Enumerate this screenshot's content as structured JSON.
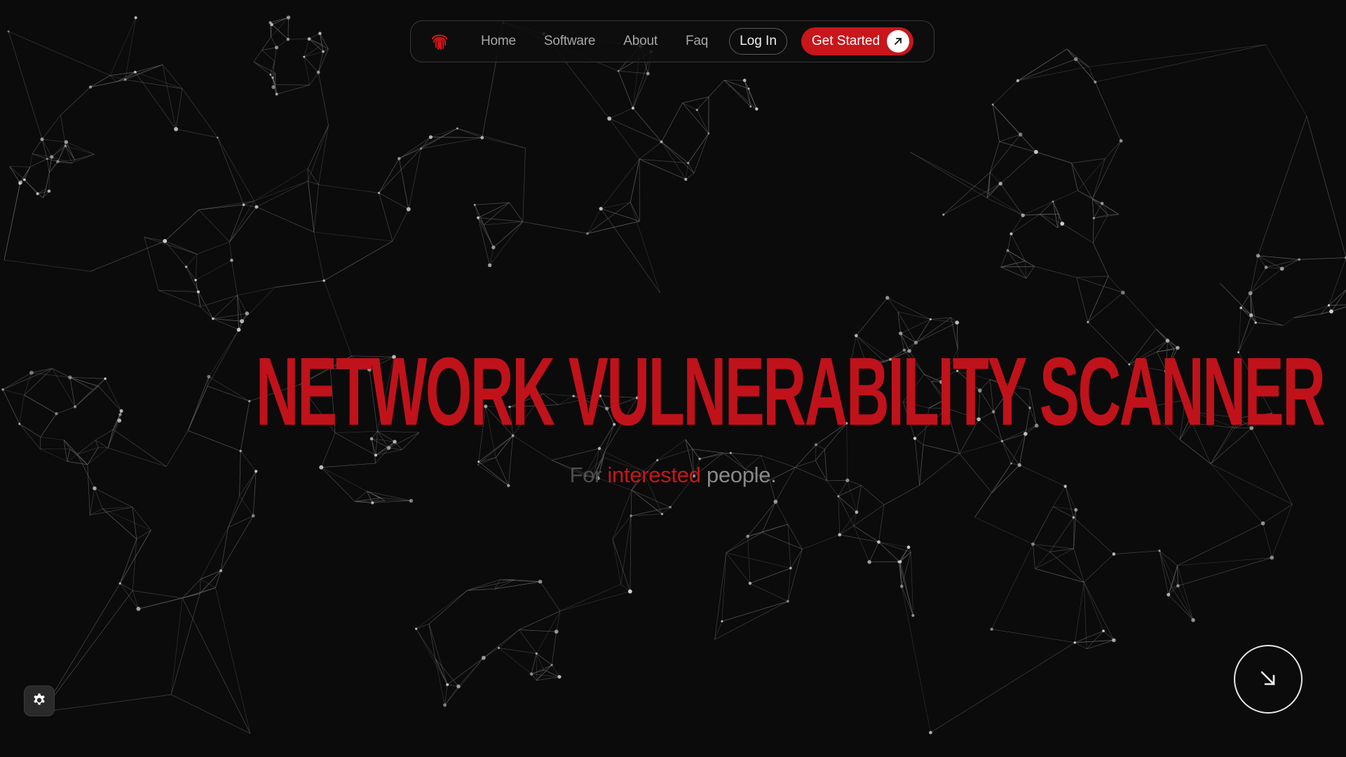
{
  "nav": {
    "logo_icon": "fingerprint-icon",
    "links": [
      "Home",
      "Software",
      "About",
      "Faq"
    ],
    "login_label": "Log In",
    "get_started_label": "Get Started",
    "get_started_icon": "arrow-up-right-icon"
  },
  "hero": {
    "title": "NETWORK VULNERABILITY SCANNER",
    "subtitle_prefix": "For",
    "subtitle_accent": "interested",
    "subtitle_suffix": "people."
  },
  "controls": {
    "scroll_icon": "arrow-down-right-icon",
    "settings_icon": "gear-icon"
  },
  "colors": {
    "background": "#0b0b0b",
    "accent": "#c8161b",
    "nav_text": "#a6a6a6",
    "network_line": "#6b6b6b",
    "network_node": "#cfcfcf"
  }
}
